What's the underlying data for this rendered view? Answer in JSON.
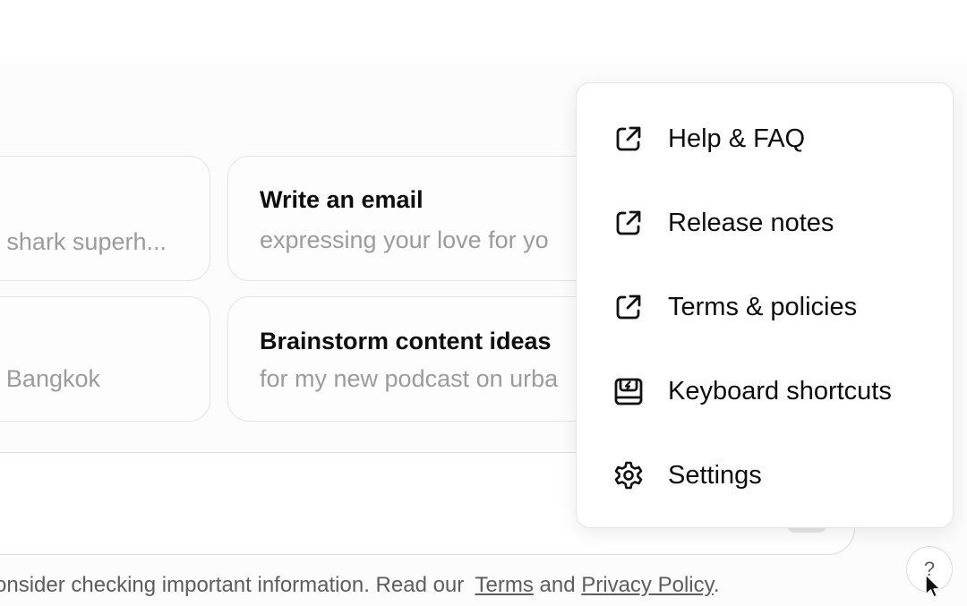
{
  "suggestions": [
    {
      "title": "",
      "subtitle": "shark superh..."
    },
    {
      "title": "Write an email",
      "subtitle": "expressing your love for yo"
    },
    {
      "title": "",
      "subtitle": "Bangkok"
    },
    {
      "title": "Brainstorm content ideas",
      "subtitle": "for my new podcast on urba"
    }
  ],
  "footer": {
    "lead": "onsider checking important information. Read our",
    "terms": "Terms",
    "and": "and",
    "privacy": "Privacy Policy",
    "end": "."
  },
  "help_button": {
    "label": "?"
  },
  "menu": {
    "items": [
      {
        "label": "Help & FAQ",
        "icon": "external-link-icon"
      },
      {
        "label": "Release notes",
        "icon": "external-link-icon"
      },
      {
        "label": "Terms & policies",
        "icon": "external-link-icon"
      },
      {
        "label": "Keyboard shortcuts",
        "icon": "keyboard-icon"
      },
      {
        "label": "Settings",
        "icon": "gear-icon"
      }
    ]
  }
}
